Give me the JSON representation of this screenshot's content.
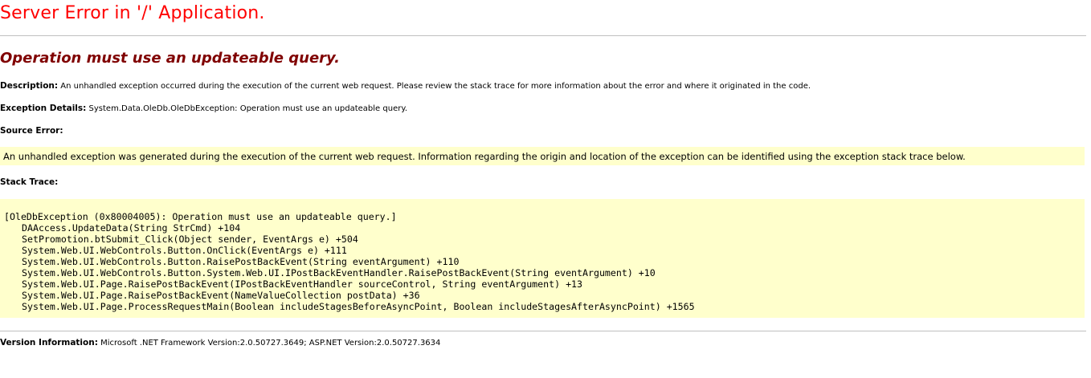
{
  "page": {
    "title": "Server Error in '/' Application.",
    "error_message": "Operation must use an updateable query."
  },
  "description": {
    "label": "Description:",
    "text": " An unhandled exception occurred during the execution of the current web request. Please review the stack trace for more information about the error and where it originated in the code."
  },
  "exception_details": {
    "label": "Exception Details:",
    "text": " System.Data.OleDb.OleDbException: Operation must use an updateable query."
  },
  "source_error": {
    "heading": "Source Error:",
    "text": "An unhandled exception was generated during the execution of the current web request. Information regarding the origin and location of the exception can be identified using the exception stack trace below."
  },
  "stack_trace": {
    "heading": "Stack Trace:",
    "lines": [
      "[OleDbException (0x80004005): Operation must use an updateable query.]",
      "DAAccess.UpdateData(String StrCmd) +104",
      "SetPromotion.btSubmit_Click(Object sender, EventArgs e) +504",
      "System.Web.UI.WebControls.Button.OnClick(EventArgs e) +111",
      "System.Web.UI.WebControls.Button.RaisePostBackEvent(String eventArgument) +110",
      "System.Web.UI.WebControls.Button.System.Web.UI.IPostBackEventHandler.RaisePostBackEvent(String eventArgument) +10",
      "System.Web.UI.Page.RaisePostBackEvent(IPostBackEventHandler sourceControl, String eventArgument) +13",
      "System.Web.UI.Page.RaisePostBackEvent(NameValueCollection postData) +36",
      "System.Web.UI.Page.ProcessRequestMain(Boolean includeStagesBeforeAsyncPoint, Boolean includeStagesAfterAsyncPoint) +1565"
    ]
  },
  "version_info": {
    "label": "Version Information:",
    "text": " Microsoft .NET Framework Version:2.0.50727.3649; ASP.NET Version:2.0.50727.3634"
  },
  "colors": {
    "title": "#ff0000",
    "error_message": "#800000",
    "code_background": "#ffffcc",
    "rule": "#c0c0c0"
  }
}
